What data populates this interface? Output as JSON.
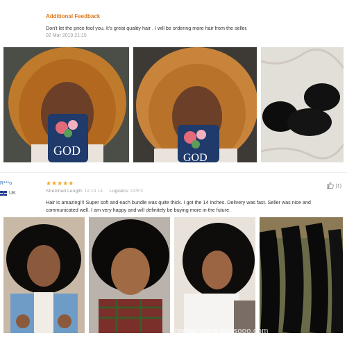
{
  "additional_feedback": {
    "title": "Additional Feedback",
    "text": "Don't let the price fool you. It's great quality hair . I will be ordering more hair from the seller.",
    "date": "02 Mar 2019 21:15"
  },
  "photos_top": [
    {
      "icon": "customer-photo-1"
    },
    {
      "icon": "customer-photo-2"
    },
    {
      "icon": "product-photo-bundles"
    }
  ],
  "phone_case_text": "GOD",
  "review": {
    "reviewer": "R***o",
    "country": "UK",
    "rating": "★★★★★",
    "stretched_length_label": "Stretched Length:",
    "stretched_length_value": "14 14 14",
    "logistics_label": "Logistics:",
    "logistics_value": "DPEX",
    "likes": "(1)",
    "text": "Hair is amazing!!! Super soft and each bundle was quite thick. I got the 14 inches. Delivery was fast. Seller was nice and communicated well. I am very happy and will definitely be buying more in the future."
  },
  "watermark": "isvhair.store.bossgoo.com",
  "colors": {
    "accent": "#e07a1f",
    "link": "#2a6ebb",
    "star": "#f5a623"
  }
}
